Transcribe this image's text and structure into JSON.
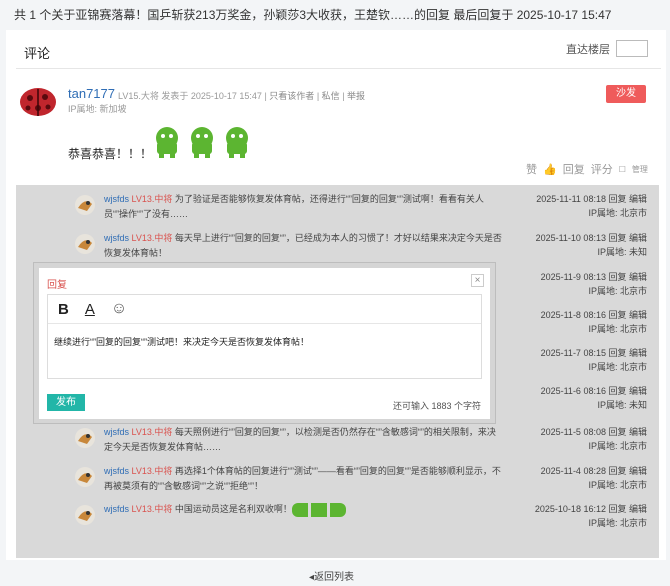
{
  "topbar": {
    "text": "共 1 个关于亚锦赛落幕！国乒斩获213万奖金，孙颖莎3大收获，王楚钦……的回复 最后回复于 2025-10-17 15:47"
  },
  "panel": {
    "title": "评论",
    "jump_label": "直达楼层"
  },
  "post": {
    "username": "tan7177",
    "level": "LV15.大将",
    "time": "发表于 2025-10-17 15:47",
    "only_author": "只看该作者",
    "message": "私信",
    "report": "举报",
    "ip": "IP属地: 新加坡",
    "sofa": "沙发",
    "content": "恭喜恭喜！！！",
    "like": "赞",
    "reply": "回复",
    "rate": "评分",
    "manage": "管理"
  },
  "replies": [
    {
      "user": "wjsfds",
      "level": "LV13.中将",
      "text": "为了验证是否能够恢复发体育帖，还得进行“”回复的回复“”测试啊！看看有关人员“”操作“”了没有……",
      "date": "2025-11-11 08:18",
      "ops": "回复 编辑",
      "ip": "IP属地: 北京市"
    },
    {
      "user": "wjsfds",
      "level": "LV13.中将",
      "text": "每天早上进行“”回复的回复“”，已经成为本人的习惯了！才好以结果来决定今天是否恢复发体育帖！",
      "date": "2025-11-10 08:13",
      "ops": "回复 编辑",
      "ip": "IP属地: 未知"
    },
    {
      "user": "",
      "level": "",
      "text": "",
      "date": "2025-11-9 08:13",
      "ops": "回复 编辑",
      "ip": "IP属地: 北京市"
    },
    {
      "user": "",
      "level": "",
      "text": "",
      "date": "2025-11-8 08:16",
      "ops": "回复 编辑",
      "ip": "IP属地: 北京市"
    },
    {
      "user": "",
      "level": "",
      "text": "",
      "date": "2025-11-7 08:15",
      "ops": "回复 编辑",
      "ip": "IP属地: 北京市"
    },
    {
      "user": "",
      "level": "",
      "text": "",
      "date": "2025-11-6 08:16",
      "ops": "回复 编辑",
      "ip": "IP属地: 未知"
    },
    {
      "user": "wjsfds",
      "level": "LV13.中将",
      "text": "每天照例进行“”回复的回复“”，以检测是否仍然存在“”含敏感词“”的相关限制，来决定今天是否恢复发体育帖……",
      "date": "2025-11-5 08:08",
      "ops": "回复 编辑",
      "ip": "IP属地: 北京市"
    },
    {
      "user": "wjsfds",
      "level": "LV13.中将",
      "text": "再选择1个体育帖的回复进行“”测试“”——看看“”回复的回复“”是否能够顺利显示，不再被莫须有的“”含敏感词“”之说“”拒绝“”！",
      "date": "2025-11-4 08:28",
      "ops": "回复 编辑",
      "ip": "IP属地: 北京市"
    },
    {
      "user": "wjsfds",
      "level": "LV13.中将",
      "text": "中国运动员这是名利双收啊！",
      "date": "2025-10-18 16:12",
      "ops": "回复 编辑",
      "ip": "IP属地: 北京市"
    }
  ],
  "dialog": {
    "title": "回复",
    "bold": "B",
    "font": "A",
    "emoji": "☺",
    "text": "继续进行“”回复的回复“”测试吧！来决定今天是否恢复发体育帖！",
    "send": "发布",
    "remain": "还可输入 1883 个字符",
    "close": "×"
  },
  "footer": {
    "back": "◂返回列表"
  },
  "icons": {
    "avatar_main": "ladybug-avatar",
    "avatar_reply": "bird-avatar",
    "emoji": "green-android-emoji"
  }
}
